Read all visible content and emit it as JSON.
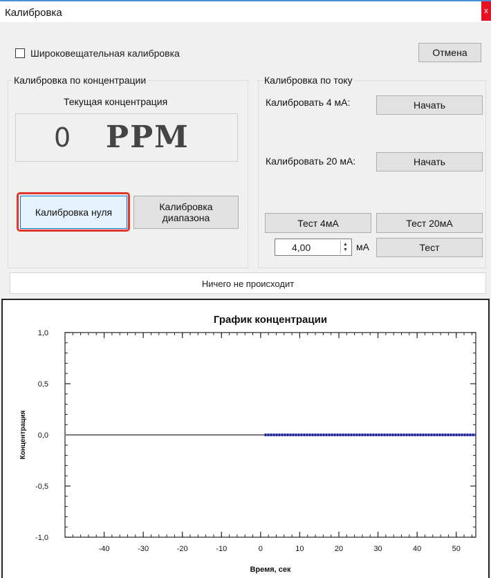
{
  "window": {
    "title": "Калибровка",
    "close_label": "x"
  },
  "broadcast_checkbox": {
    "label": "Широковещательная калибровка",
    "checked": false
  },
  "cancel_button": "Отмена",
  "concentration_group": {
    "legend": "Калибровка по концентрации",
    "current_label": "Текущая концентрация",
    "value": "0",
    "unit": "PPM",
    "zero_button": "Калибровка нуля",
    "span_button_line1": "Калибровка",
    "span_button_line2": "диапазона"
  },
  "current_group": {
    "legend": "Калибровка по току",
    "cal4_label": "Калибровать 4 мА:",
    "cal4_button": "Начать",
    "cal20_label": "Калибровать 20 мА:",
    "cal20_button": "Начать",
    "test4_button": "Тест 4мА",
    "test20_button": "Тест 20мА",
    "spin_value": "4,00",
    "spin_unit": "мА",
    "test_button": "Тест"
  },
  "status": "Ничего не происходит",
  "chart_data": {
    "type": "line",
    "title": "График концентрации",
    "xlabel": "Время, сек",
    "ylabel": "Концентрация",
    "xlim": [
      -50,
      55
    ],
    "ylim": [
      -1.0,
      1.0
    ],
    "x_ticks": [
      "-40",
      "-30",
      "-20",
      "-10",
      "0",
      "10",
      "20",
      "30",
      "40",
      "50"
    ],
    "x_tick_values": [
      -40,
      -30,
      -20,
      -10,
      0,
      10,
      20,
      30,
      40,
      50
    ],
    "y_ticks": [
      "1,0",
      "0,5",
      "0,0",
      "-0,5",
      "-1,0"
    ],
    "y_tick_values": [
      1.0,
      0.5,
      0.0,
      -0.5,
      -1.0
    ],
    "baseline": {
      "y": 0.0,
      "color": "#777777"
    },
    "series": [
      {
        "x_start": 1,
        "x_end": 55,
        "y": 0.0,
        "color": "#1f2aa8"
      }
    ],
    "grid": false
  }
}
